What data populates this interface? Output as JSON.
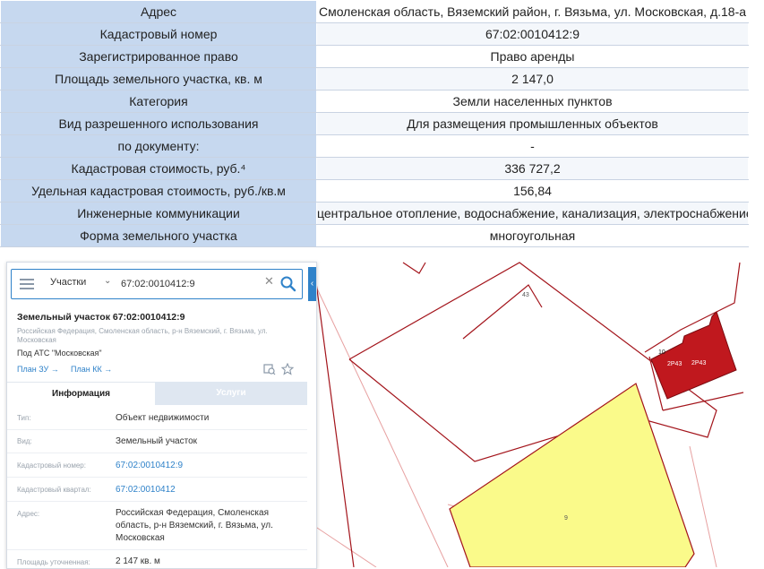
{
  "info_table": {
    "rows": [
      {
        "label": "Адрес",
        "value": "Смоленская область, Вяземский район, г. Вязьма, ул. Московская, д.18-а"
      },
      {
        "label": "Кадастровый номер",
        "value": "67:02:0010412:9"
      },
      {
        "label": "Зарегистрированное право",
        "value": "Право аренды"
      },
      {
        "label": "Площадь земельного участка, кв. м",
        "value": "2 147,0"
      },
      {
        "label": "Категория",
        "value": "Земли населенных пунктов"
      },
      {
        "label": "Вид разрешенного использования",
        "value": "Для размещения промышленных объектов"
      },
      {
        "label": "по документу:",
        "value": "-"
      },
      {
        "label": "Кадастровая стоимость, руб.⁴",
        "value": "336 727,2"
      },
      {
        "label": "Удельная кадастровая стоимость, руб./кв.м",
        "value": "156,84"
      },
      {
        "label": "Инженерные коммуникации",
        "value": "центральное отопление, водоснабжение, канализация, электроснабжение"
      },
      {
        "label": "Форма земельного участка",
        "value": "многоугольная"
      }
    ]
  },
  "panel": {
    "search_type": "Участки",
    "search_value": "67:02:0010412:9",
    "object_title": "Земельный участок 67:02:0010412:9",
    "object_address": "Российская Федерация, Смоленская область, р-н Вяземский, г. Вязьма, ул. Московская",
    "object_owner": "Под АТС \"Московская\"",
    "plan_zu": "План ЗУ →",
    "plan_kk": "План КК →",
    "tabs": {
      "info": "Информация",
      "services": "Услуги"
    },
    "attributes": [
      {
        "label": "Тип:",
        "value": "Объект недвижимости"
      },
      {
        "label": "Вид:",
        "value": "Земельный участок"
      },
      {
        "label": "Кадастровый номер:",
        "value": "67:02:0010412:9"
      },
      {
        "label": "Кадастровый квартал:",
        "value": "67:02:0010412"
      },
      {
        "label": "Адрес:",
        "value": "Российская Федерация, Смоленская область, р-н Вяземский, г. Вязьма, ул. Московская"
      },
      {
        "label": "Площадь уточненная:",
        "value": "2 147 кв. м"
      }
    ]
  },
  "map": {
    "labels": {
      "parcel_43": "43",
      "parcel_10": "10",
      "building_1": "2Р43",
      "building_2": "2Р43",
      "parcel_9": "9"
    },
    "colors": {
      "selected_parcel": "#fafa8a",
      "building": "#c0181e",
      "boundary": "#a3141b",
      "faint_boundary": "#e7a1a1"
    }
  }
}
